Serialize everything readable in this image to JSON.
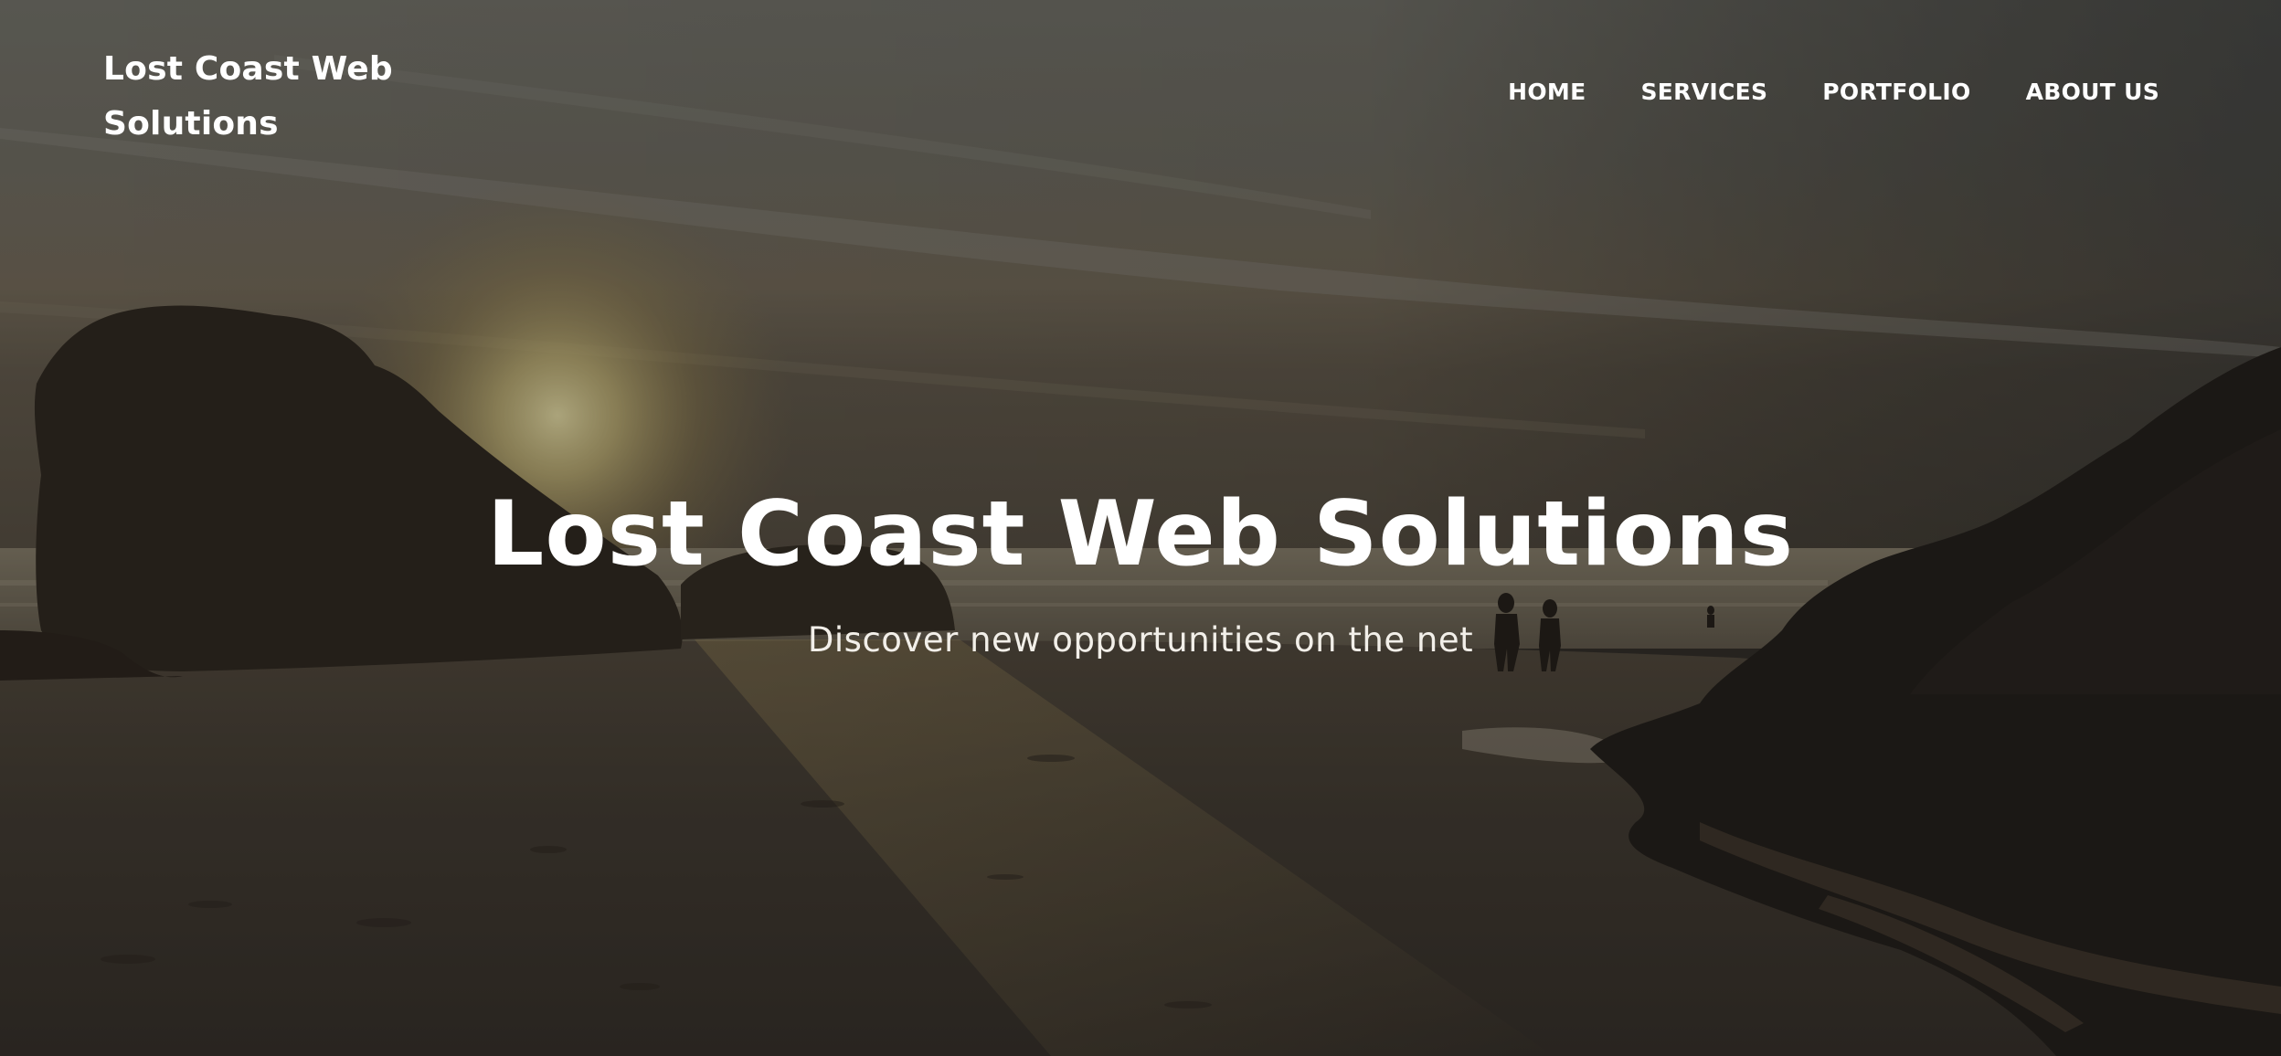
{
  "header": {
    "brand": "Lost Coast Web Solutions",
    "nav": [
      {
        "label": "HOME"
      },
      {
        "label": "SERVICES"
      },
      {
        "label": "PORTFOLIO"
      },
      {
        "label": "ABOUT US"
      }
    ]
  },
  "hero": {
    "title": "Lost Coast Web Solutions",
    "subtitle": "Discover new opportunities on the net",
    "background": "beach-sunset-photo"
  },
  "colors": {
    "text": "#ffffff",
    "overlay": "#1e1b18",
    "sky": "#6b6a62",
    "sand": "#3a322a"
  }
}
